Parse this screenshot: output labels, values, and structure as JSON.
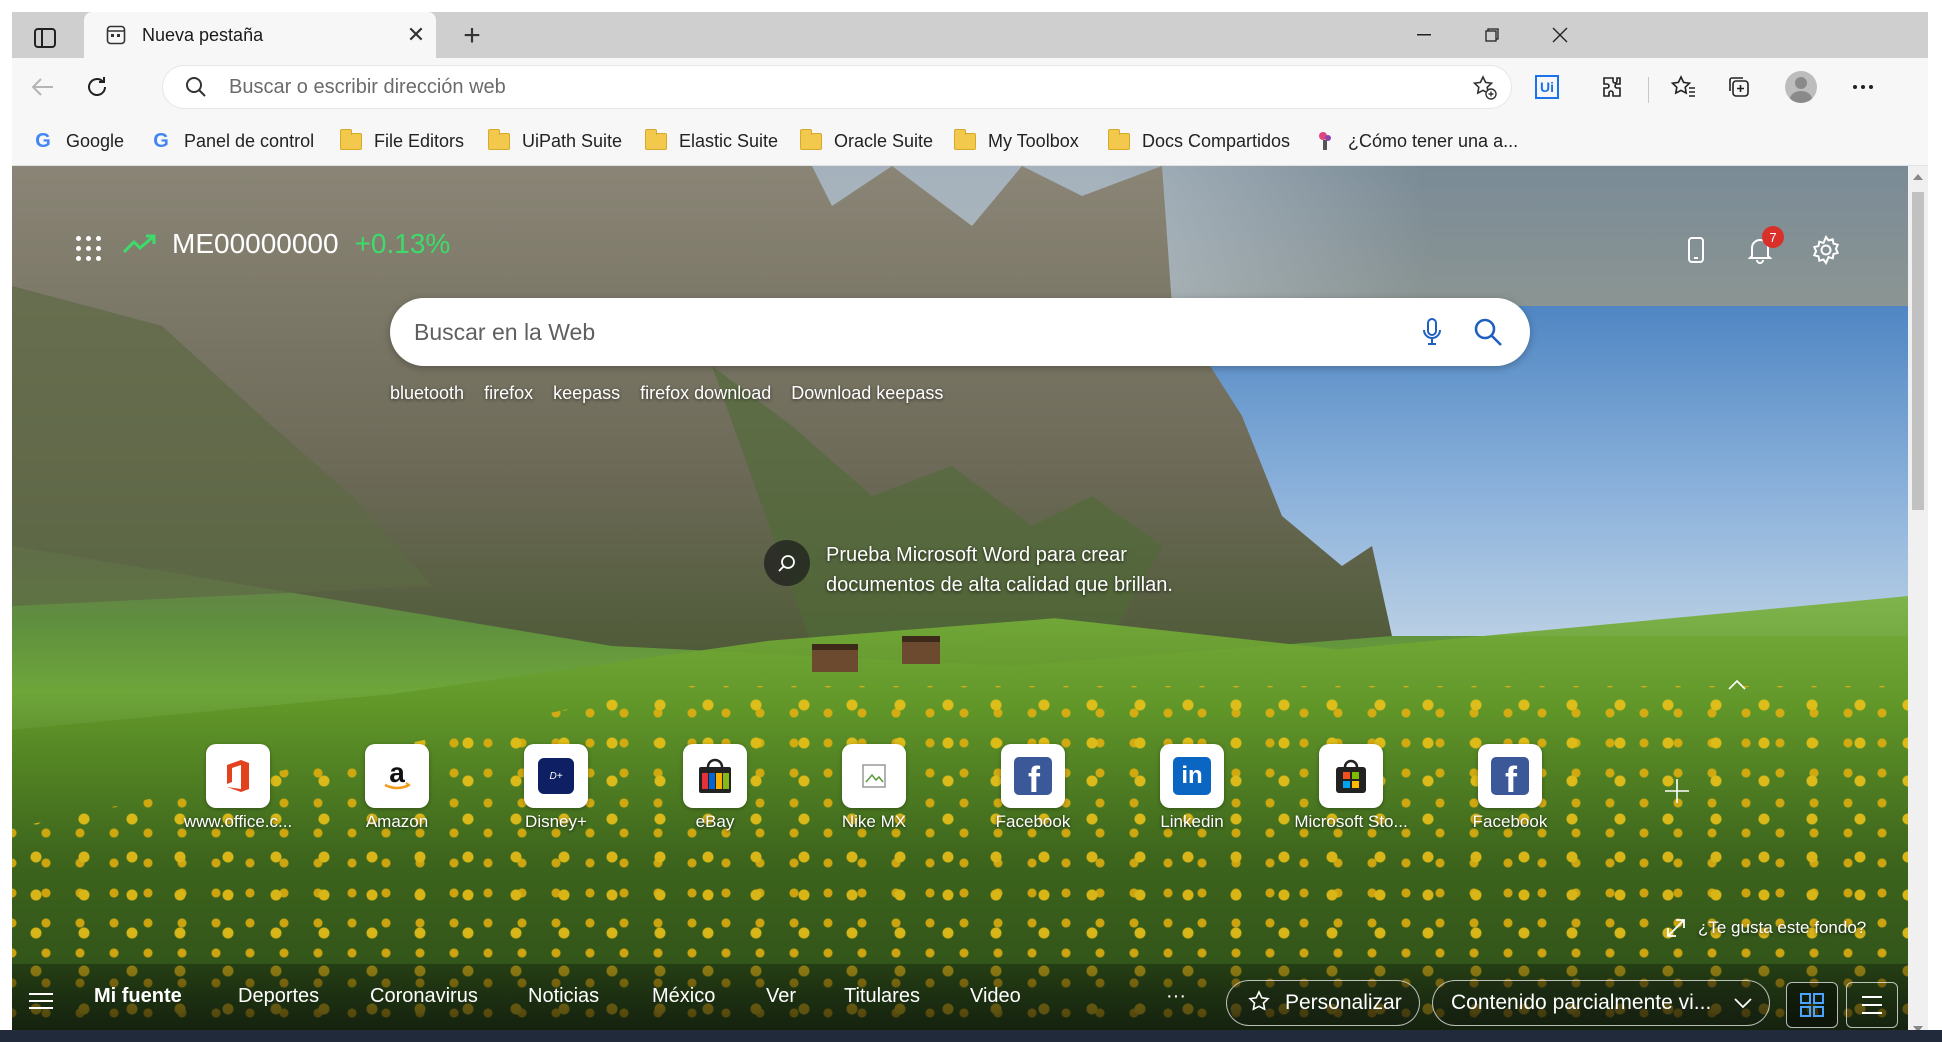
{
  "window": {
    "tab_title": "Nueva pestaña",
    "close_tab": "✕",
    "new_tab": "+"
  },
  "toolbar": {
    "address_placeholder": "Buscar o escribir dirección web",
    "extension_label": "Ui"
  },
  "bookmarks": [
    {
      "label": "Google",
      "icon": "google-icon"
    },
    {
      "label": "Panel de control",
      "icon": "google-icon"
    },
    {
      "label": "File Editors",
      "icon": "folder-icon"
    },
    {
      "label": "UiPath Suite",
      "icon": "folder-icon"
    },
    {
      "label": "Elastic Suite",
      "icon": "folder-icon"
    },
    {
      "label": "Oracle Suite",
      "icon": "folder-icon"
    },
    {
      "label": "My Toolbox",
      "icon": "folder-icon"
    },
    {
      "label": "Docs Compartidos",
      "icon": "folder-icon"
    },
    {
      "label": "¿Cómo tener una a...",
      "icon": "page-icon"
    }
  ],
  "newtab": {
    "ticker_symbol": "ME00000000",
    "ticker_change": "+0.13%",
    "ticker_change_color": "#3ddc6a",
    "notifications_count": "7",
    "search_placeholder": "Buscar en la Web",
    "trending": [
      "bluetooth",
      "firefox",
      "keepass",
      "firefox download",
      "Download keepass"
    ],
    "promo_text": "Prueba Microsoft Word para crear documentos de alta calidad que brillan.",
    "tiles": [
      {
        "label": "www.office.c...",
        "icon": "office-icon"
      },
      {
        "label": "Amazon",
        "icon": "amazon-icon"
      },
      {
        "label": "Disney+",
        "icon": "disney-plus-icon"
      },
      {
        "label": "eBay",
        "icon": "ebay-icon"
      },
      {
        "label": "Nike MX",
        "icon": "broken-image-icon"
      },
      {
        "label": "Facebook",
        "icon": "facebook-icon"
      },
      {
        "label": "Linkedin",
        "icon": "linkedin-icon"
      },
      {
        "label": "Microsoft Sto...",
        "icon": "microsoft-store-icon"
      },
      {
        "label": "Facebook",
        "icon": "facebook-icon"
      }
    ],
    "like_background": "¿Te gusta este fondo?"
  },
  "feed": {
    "nav": [
      "Mi fuente",
      "Deportes",
      "Coronavirus",
      "Noticias",
      "México",
      "Ver",
      "Titulares",
      "Video"
    ],
    "more": "···",
    "personalize": "Personalizar",
    "content_visibility": "Contenido parcialmente vi..."
  },
  "colors": {
    "accent": "#0078d4",
    "badge": "#d9302a"
  }
}
